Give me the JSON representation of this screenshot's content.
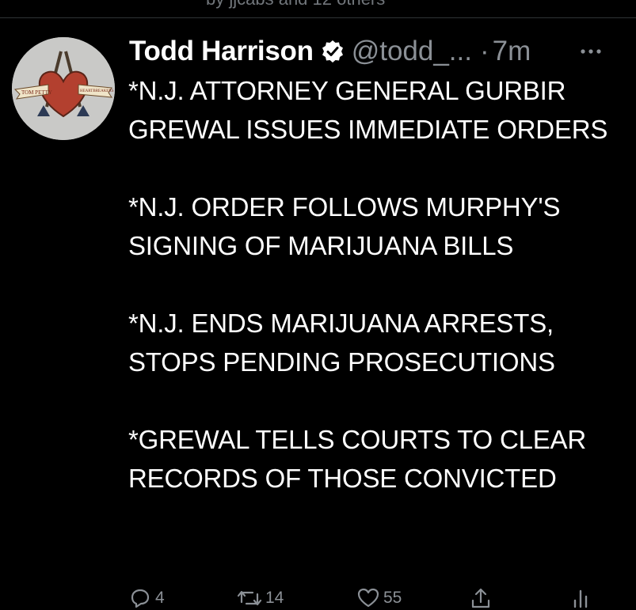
{
  "top_context": {
    "text": "by jjcabs and 12 others"
  },
  "tweet": {
    "author": {
      "display_name": "Todd Harrison",
      "handle": "@todd_...",
      "verified": true,
      "avatar_banner_left": "TOM PETTY",
      "avatar_banner_right": "HEARTBREAKERS"
    },
    "dot": "·",
    "time": "7m",
    "more_icon": "more-horizontal-icon",
    "paragraphs": [
      "*N.J. ATTORNEY GENERAL GURBIR GREWAL ISSUES IMMEDIATE ORDERS",
      "*N.J. ORDER FOLLOWS MURPHY'S SIGNING OF MARIJUANA BILLS",
      "*N.J. ENDS MARIJUANA ARRESTS, STOPS PENDING PROSECUTIONS",
      "*GREWAL TELLS COURTS TO CLEAR RECORDS OF THOSE CONVICTED"
    ],
    "actions": {
      "reply": {
        "icon": "reply-icon",
        "count": "4"
      },
      "retweet": {
        "icon": "retweet-icon",
        "count": "14"
      },
      "like": {
        "icon": "heart-icon",
        "count": "55"
      },
      "share": {
        "icon": "share-icon",
        "count": ""
      },
      "analytics": {
        "icon": "analytics-icon",
        "count": ""
      }
    }
  },
  "colors": {
    "background": "#000000",
    "text_primary": "#ffffff",
    "text_secondary": "#8b9096",
    "divider": "#2f3336",
    "avatar_bg": "#c9c9c7",
    "heart_red": "#b3402f"
  }
}
